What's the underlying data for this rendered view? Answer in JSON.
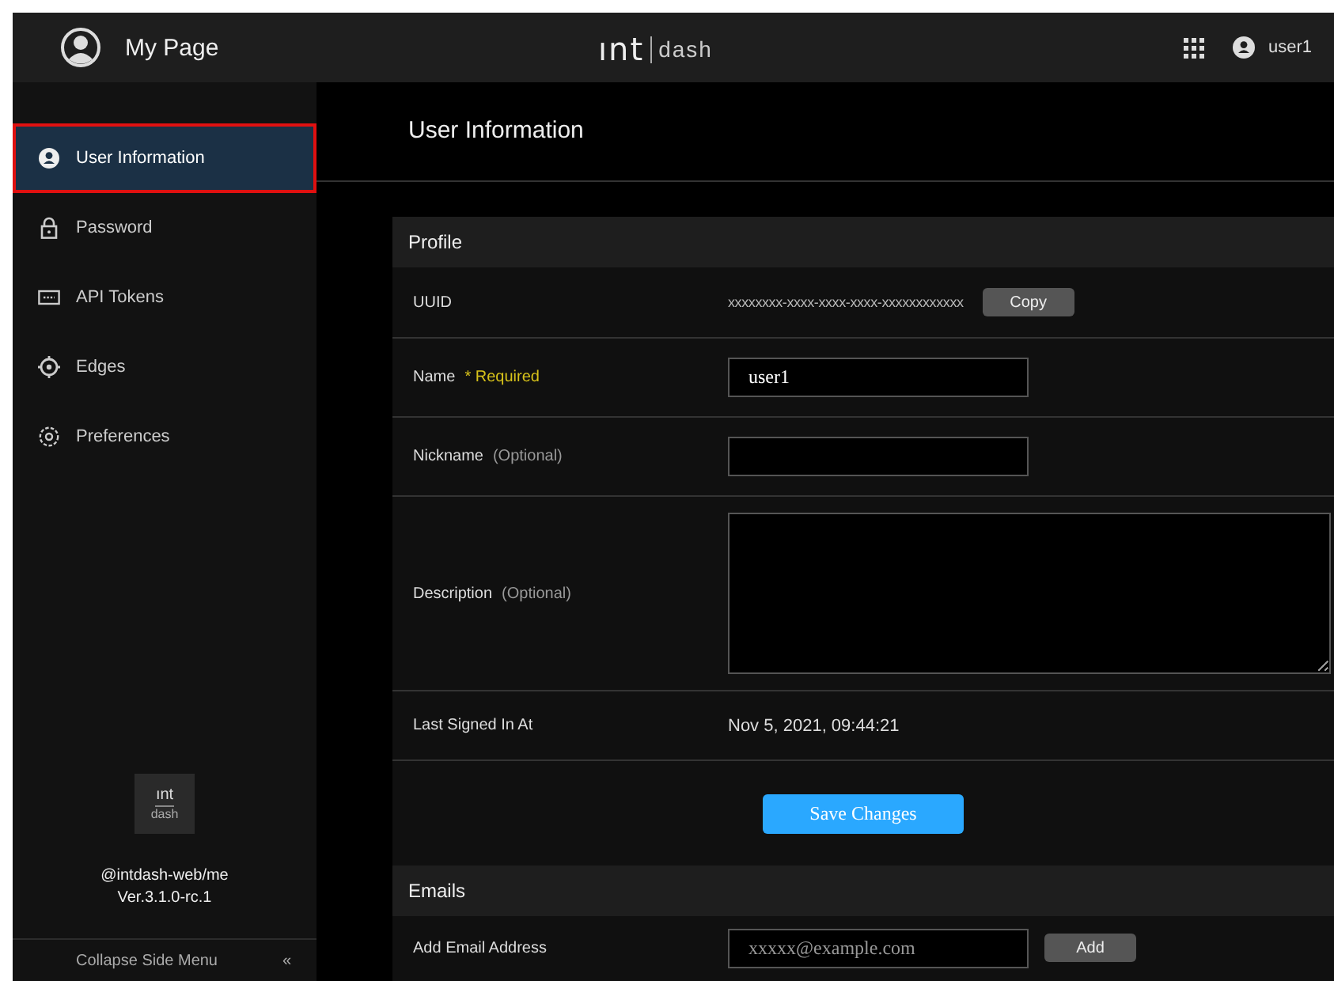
{
  "header": {
    "title": "My Page",
    "logo": {
      "left": "ınt",
      "right": "dash"
    },
    "user": "user1"
  },
  "sidebar": {
    "items": [
      {
        "label": "User Information",
        "kind": "user",
        "selected": true
      },
      {
        "label": "Password",
        "kind": "lock",
        "selected": false
      },
      {
        "label": "API Tokens",
        "kind": "token",
        "selected": false
      },
      {
        "label": "Edges",
        "kind": "target",
        "selected": false
      },
      {
        "label": "Preferences",
        "kind": "gear",
        "selected": false
      }
    ],
    "logo": {
      "top": "ınt",
      "bottom": "dash"
    },
    "package": "@intdash-web/me",
    "version": "Ver.3.1.0-rc.1",
    "collapse": "Collapse Side Menu",
    "collapse_icon": "«"
  },
  "page_title": "User Information",
  "profile": {
    "heading": "Profile",
    "rows": [
      {
        "kind": "copy",
        "label": "UUID",
        "value": "xxxxxxxx-xxxx-xxxx-xxxx-xxxxxxxxxxxx",
        "button": "Copy"
      },
      {
        "kind": "input",
        "label": "Name",
        "note": "* Required",
        "required": true,
        "value": "user1"
      },
      {
        "kind": "input",
        "label": "Nickname",
        "note": "(Optional)",
        "required": false
      },
      {
        "kind": "textarea",
        "label": "Description",
        "note": "(Optional)",
        "required": false
      },
      {
        "kind": "text",
        "label": "Last Signed In At",
        "value": "Nov 5, 2021, 09:44:21"
      }
    ],
    "save": "Save Changes"
  },
  "emails": {
    "heading": "Emails",
    "label": "Add Email Address",
    "placeholder": "xxxxx@example.com",
    "button": "Add"
  }
}
